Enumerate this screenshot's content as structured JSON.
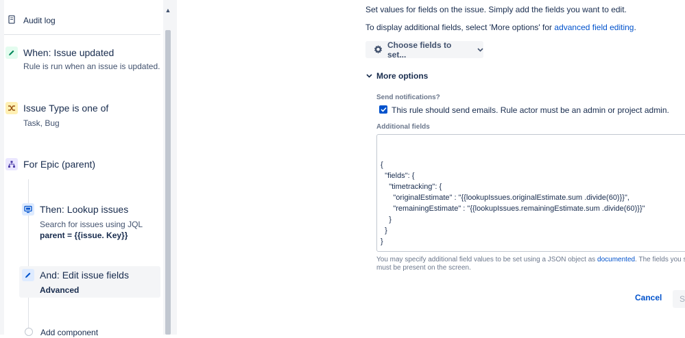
{
  "sidebar": {
    "audit_log": "Audit log",
    "items": [
      {
        "title": "When: Issue updated",
        "subtitle": "Rule is run when an issue is updated.",
        "icon": "pencil-icon"
      },
      {
        "title": "Issue Type is one of",
        "subtitle": "Task, Bug",
        "icon": "shuffle-icon"
      },
      {
        "title": "For Epic (parent)",
        "icon": "hierarchy-icon"
      },
      {
        "title": "Then: Lookup issues",
        "subtitle": "Search for issues using JQL",
        "subtitle2": "parent = {{issue. Key}}",
        "icon": "monitor-icon"
      },
      {
        "title": "And: Edit issue fields",
        "subtitle": "Advanced",
        "icon": "pencil-icon"
      }
    ],
    "add_component": "Add component"
  },
  "main": {
    "intro": "Set values for fields on the issue. Simply add the fields you want to edit.",
    "additional_pre": "To display additional fields, select 'More options' for ",
    "additional_link": "advanced field editing",
    "additional_post": ".",
    "choose_fields": "Choose fields to set...",
    "more_options": "More options",
    "send_notifications_label": "Send notifications?",
    "send_notifications_text": "This rule should send emails. Rule actor must be an admin or project admin.",
    "send_notifications_checked": true,
    "additional_fields_label": "Additional fields",
    "code_lines": [
      "{",
      "  \"fields\": {",
      "    \"timetracking\": {",
      "      \"originalEstimate\" : \"{{lookupIssues.originalEstimate.sum .divide(60)}}\",",
      "      \"remainingEstimate\" : \"{{lookupIssues.remainingEstimate.sum .divide(60)}}\"",
      "    }",
      "  }",
      "}"
    ],
    "help_pre": "You may specify additional field values to be set using a JSON object as ",
    "help_link": "documented",
    "help_post": ". The fields you specif",
    "help_line2": "must be present on the screen.",
    "cancel": "Cancel",
    "save": "Sa"
  },
  "colors": {
    "accent": "#0052cc",
    "text": "#172b4d",
    "muted": "#6b778c"
  }
}
